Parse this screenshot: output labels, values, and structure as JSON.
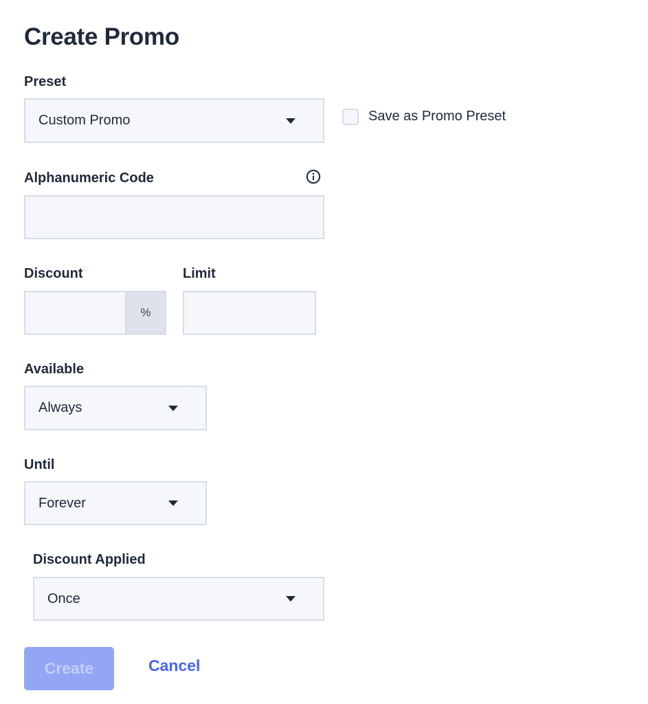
{
  "page": {
    "title": "Create Promo"
  },
  "preset": {
    "label": "Preset",
    "value": "Custom Promo"
  },
  "save_preset": {
    "label": "Save as Promo Preset",
    "checked": false
  },
  "code": {
    "label": "Alphanumeric Code",
    "value": "",
    "placeholder": ""
  },
  "discount": {
    "label": "Discount",
    "value": "",
    "suffix": "%"
  },
  "limit": {
    "label": "Limit",
    "value": ""
  },
  "available": {
    "label": "Available",
    "value": "Always"
  },
  "until": {
    "label": "Until",
    "value": "Forever"
  },
  "discount_applied": {
    "label": "Discount Applied",
    "value": "Once"
  },
  "actions": {
    "create_label": "Create",
    "cancel_label": "Cancel"
  },
  "colors": {
    "primary": "#4a67e8",
    "primary_disabled": "#93a6f5",
    "field_bg": "#f5f7fb",
    "field_border": "#d6dde9",
    "text": "#1f2a3a"
  }
}
